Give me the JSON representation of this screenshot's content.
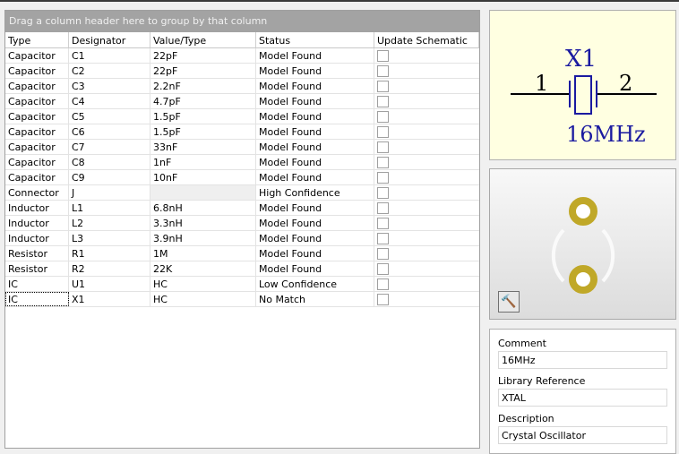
{
  "grid": {
    "group_hint": "Drag a column header here to group by that column",
    "columns": [
      "Type",
      "Designator",
      "Value/Type",
      "Status",
      "Update Schematic"
    ],
    "rows": [
      {
        "type": "Capacitor",
        "designator": "C1",
        "value": "22pF",
        "status": "Model Found",
        "update": false
      },
      {
        "type": "Capacitor",
        "designator": "C2",
        "value": "22pF",
        "status": "Model Found",
        "update": false
      },
      {
        "type": "Capacitor",
        "designator": "C3",
        "value": "2.2nF",
        "status": "Model Found",
        "update": false
      },
      {
        "type": "Capacitor",
        "designator": "C4",
        "value": "4.7pF",
        "status": "Model Found",
        "update": false
      },
      {
        "type": "Capacitor",
        "designator": "C5",
        "value": "1.5pF",
        "status": "Model Found",
        "update": false
      },
      {
        "type": "Capacitor",
        "designator": "C6",
        "value": "1.5pF",
        "status": "Model Found",
        "update": false
      },
      {
        "type": "Capacitor",
        "designator": "C7",
        "value": "33nF",
        "status": "Model Found",
        "update": false
      },
      {
        "type": "Capacitor",
        "designator": "C8",
        "value": "1nF",
        "status": "Model Found",
        "update": false
      },
      {
        "type": "Capacitor",
        "designator": "C9",
        "value": "10nF",
        "status": "Model Found",
        "update": false
      },
      {
        "type": "Connector",
        "designator": "J",
        "value": "",
        "status": "High Confidence",
        "update": false
      },
      {
        "type": "Inductor",
        "designator": "L1",
        "value": "6.8nH",
        "status": "Model Found",
        "update": false
      },
      {
        "type": "Inductor",
        "designator": "L2",
        "value": "3.3nH",
        "status": "Model Found",
        "update": false
      },
      {
        "type": "Inductor",
        "designator": "L3",
        "value": "3.9nH",
        "status": "Model Found",
        "update": false
      },
      {
        "type": "Resistor",
        "designator": "R1",
        "value": "1M",
        "status": "Model Found",
        "update": false
      },
      {
        "type": "Resistor",
        "designator": "R2",
        "value": "22K",
        "status": "Model Found",
        "update": false
      },
      {
        "type": "IC",
        "designator": "U1",
        "value": "HC",
        "status": "Low Confidence",
        "update": false
      },
      {
        "type": "IC",
        "designator": "X1",
        "value": "HC",
        "status": "No Match",
        "update": false
      }
    ]
  },
  "schematic": {
    "designator": "X1",
    "pin1": "1",
    "pin2": "2",
    "value": "16MHz",
    "color": "#1a1aa0"
  },
  "footprint": {
    "pad_color": "#c0a828",
    "tool_icon": "hammer-filter-icon"
  },
  "properties": {
    "comment_label": "Comment",
    "comment": "16MHz",
    "libref_label": "Library Reference",
    "libref": "XTAL",
    "description_label": "Description",
    "description": "Crystal Oscillator"
  }
}
